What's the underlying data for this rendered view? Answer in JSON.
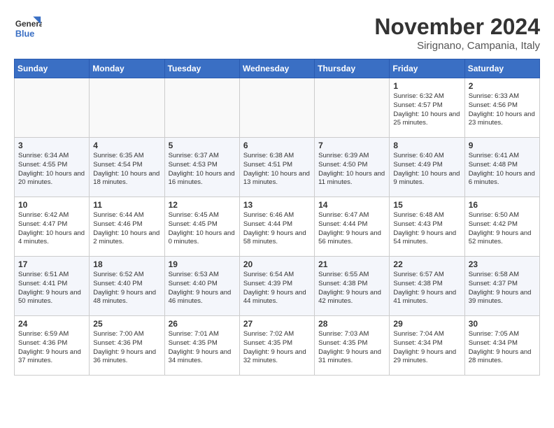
{
  "header": {
    "logo_line1": "General",
    "logo_line2": "Blue",
    "month": "November 2024",
    "location": "Sirignano, Campania, Italy"
  },
  "weekdays": [
    "Sunday",
    "Monday",
    "Tuesday",
    "Wednesday",
    "Thursday",
    "Friday",
    "Saturday"
  ],
  "weeks": [
    [
      {
        "day": "",
        "info": ""
      },
      {
        "day": "",
        "info": ""
      },
      {
        "day": "",
        "info": ""
      },
      {
        "day": "",
        "info": ""
      },
      {
        "day": "",
        "info": ""
      },
      {
        "day": "1",
        "info": "Sunrise: 6:32 AM\nSunset: 4:57 PM\nDaylight: 10 hours and 25 minutes."
      },
      {
        "day": "2",
        "info": "Sunrise: 6:33 AM\nSunset: 4:56 PM\nDaylight: 10 hours and 23 minutes."
      }
    ],
    [
      {
        "day": "3",
        "info": "Sunrise: 6:34 AM\nSunset: 4:55 PM\nDaylight: 10 hours and 20 minutes."
      },
      {
        "day": "4",
        "info": "Sunrise: 6:35 AM\nSunset: 4:54 PM\nDaylight: 10 hours and 18 minutes."
      },
      {
        "day": "5",
        "info": "Sunrise: 6:37 AM\nSunset: 4:53 PM\nDaylight: 10 hours and 16 minutes."
      },
      {
        "day": "6",
        "info": "Sunrise: 6:38 AM\nSunset: 4:51 PM\nDaylight: 10 hours and 13 minutes."
      },
      {
        "day": "7",
        "info": "Sunrise: 6:39 AM\nSunset: 4:50 PM\nDaylight: 10 hours and 11 minutes."
      },
      {
        "day": "8",
        "info": "Sunrise: 6:40 AM\nSunset: 4:49 PM\nDaylight: 10 hours and 9 minutes."
      },
      {
        "day": "9",
        "info": "Sunrise: 6:41 AM\nSunset: 4:48 PM\nDaylight: 10 hours and 6 minutes."
      }
    ],
    [
      {
        "day": "10",
        "info": "Sunrise: 6:42 AM\nSunset: 4:47 PM\nDaylight: 10 hours and 4 minutes."
      },
      {
        "day": "11",
        "info": "Sunrise: 6:44 AM\nSunset: 4:46 PM\nDaylight: 10 hours and 2 minutes."
      },
      {
        "day": "12",
        "info": "Sunrise: 6:45 AM\nSunset: 4:45 PM\nDaylight: 10 hours and 0 minutes."
      },
      {
        "day": "13",
        "info": "Sunrise: 6:46 AM\nSunset: 4:44 PM\nDaylight: 9 hours and 58 minutes."
      },
      {
        "day": "14",
        "info": "Sunrise: 6:47 AM\nSunset: 4:44 PM\nDaylight: 9 hours and 56 minutes."
      },
      {
        "day": "15",
        "info": "Sunrise: 6:48 AM\nSunset: 4:43 PM\nDaylight: 9 hours and 54 minutes."
      },
      {
        "day": "16",
        "info": "Sunrise: 6:50 AM\nSunset: 4:42 PM\nDaylight: 9 hours and 52 minutes."
      }
    ],
    [
      {
        "day": "17",
        "info": "Sunrise: 6:51 AM\nSunset: 4:41 PM\nDaylight: 9 hours and 50 minutes."
      },
      {
        "day": "18",
        "info": "Sunrise: 6:52 AM\nSunset: 4:40 PM\nDaylight: 9 hours and 48 minutes."
      },
      {
        "day": "19",
        "info": "Sunrise: 6:53 AM\nSunset: 4:40 PM\nDaylight: 9 hours and 46 minutes."
      },
      {
        "day": "20",
        "info": "Sunrise: 6:54 AM\nSunset: 4:39 PM\nDaylight: 9 hours and 44 minutes."
      },
      {
        "day": "21",
        "info": "Sunrise: 6:55 AM\nSunset: 4:38 PM\nDaylight: 9 hours and 42 minutes."
      },
      {
        "day": "22",
        "info": "Sunrise: 6:57 AM\nSunset: 4:38 PM\nDaylight: 9 hours and 41 minutes."
      },
      {
        "day": "23",
        "info": "Sunrise: 6:58 AM\nSunset: 4:37 PM\nDaylight: 9 hours and 39 minutes."
      }
    ],
    [
      {
        "day": "24",
        "info": "Sunrise: 6:59 AM\nSunset: 4:36 PM\nDaylight: 9 hours and 37 minutes."
      },
      {
        "day": "25",
        "info": "Sunrise: 7:00 AM\nSunset: 4:36 PM\nDaylight: 9 hours and 36 minutes."
      },
      {
        "day": "26",
        "info": "Sunrise: 7:01 AM\nSunset: 4:35 PM\nDaylight: 9 hours and 34 minutes."
      },
      {
        "day": "27",
        "info": "Sunrise: 7:02 AM\nSunset: 4:35 PM\nDaylight: 9 hours and 32 minutes."
      },
      {
        "day": "28",
        "info": "Sunrise: 7:03 AM\nSunset: 4:35 PM\nDaylight: 9 hours and 31 minutes."
      },
      {
        "day": "29",
        "info": "Sunrise: 7:04 AM\nSunset: 4:34 PM\nDaylight: 9 hours and 29 minutes."
      },
      {
        "day": "30",
        "info": "Sunrise: 7:05 AM\nSunset: 4:34 PM\nDaylight: 9 hours and 28 minutes."
      }
    ]
  ]
}
